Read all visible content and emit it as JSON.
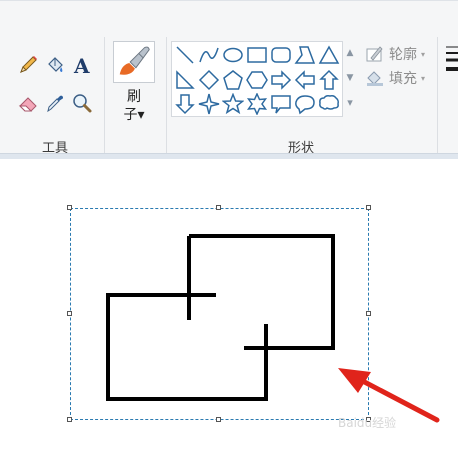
{
  "ribbon": {
    "tools_group_label": "工具",
    "brush_label_line1": "刷",
    "brush_label_line2": "子▾",
    "shapes_group_label": "形状",
    "outline_label": "轮廓",
    "fill_label": "填充",
    "caret": "▾"
  },
  "gallery": {
    "scroll_up": "▲",
    "scroll_down": "▼",
    "more": "▾"
  },
  "icons": {
    "pencil": "pencil-icon",
    "fill_bucket": "fill-bucket-icon",
    "text": "text-icon",
    "eraser": "eraser-icon",
    "color_picker": "color-picker-icon",
    "magnifier": "magnifier-icon",
    "brush": "brush-icon",
    "outline": "outline-icon",
    "fill": "fill-icon"
  },
  "tools_text_glyph": "A",
  "watermark": "Baidu经验",
  "colors": {
    "accent": "#2a7ab0",
    "shape_stroke": "#2d6aa0",
    "arrow": "#e0241b",
    "ink": "#000000"
  }
}
